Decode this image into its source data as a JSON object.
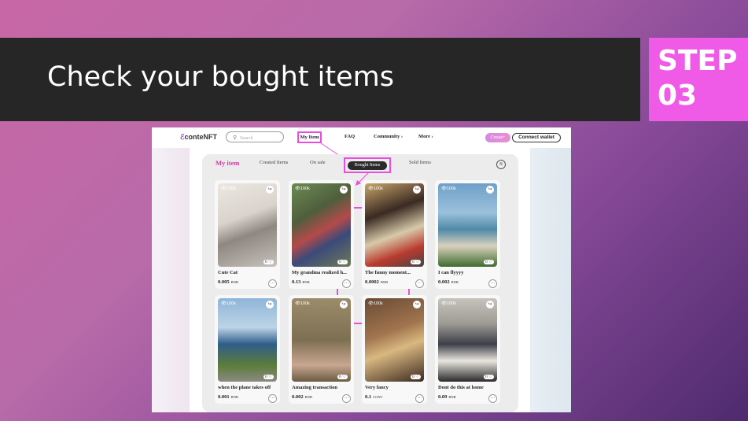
{
  "slide": {
    "title": "Check your bought items",
    "step_label": "STEP",
    "step_number": "03",
    "accent_color": "#ef5ae6"
  },
  "app": {
    "logo": "conteNFT",
    "search_placeholder": "Search",
    "nav": [
      "My Item",
      "FAQ",
      "Community ›",
      "More ›"
    ],
    "create_label": "Create+",
    "wallet_label": "Connect wallet"
  },
  "tabs": {
    "title": "My item",
    "items": [
      "Created Items",
      "On sale",
      "Bought Items",
      "Sold Items"
    ],
    "active": "Bought Items"
  },
  "cards": [
    {
      "views": "100k",
      "likes": "0",
      "name": "Cute Cat",
      "price": "0.005",
      "currency": "BNB"
    },
    {
      "views": "100k",
      "likes": "0",
      "name": "My grandma realized h...",
      "price": "0.13",
      "currency": "BNB"
    },
    {
      "views": "100k",
      "likes": "0",
      "name": "The funny moment...",
      "price": "0.0002",
      "currency": "BNB"
    },
    {
      "views": "100k",
      "likes": "0",
      "name": "I can flyyyy",
      "price": "0.002",
      "currency": "BNB"
    },
    {
      "views": "100k",
      "likes": "0",
      "name": "when the plane takes off",
      "price": "0.001",
      "currency": "BNB"
    },
    {
      "views": "100k",
      "likes": "0",
      "name": "Amazing transaction",
      "price": "0.002",
      "currency": "BNB"
    },
    {
      "views": "100k",
      "likes": "0",
      "name": "Very fancy",
      "price": "0.1",
      "currency": "CONT"
    },
    {
      "views": "100k",
      "likes": "0",
      "name": "Dont do this at home",
      "price": "0.09",
      "currency": "BNB"
    }
  ]
}
